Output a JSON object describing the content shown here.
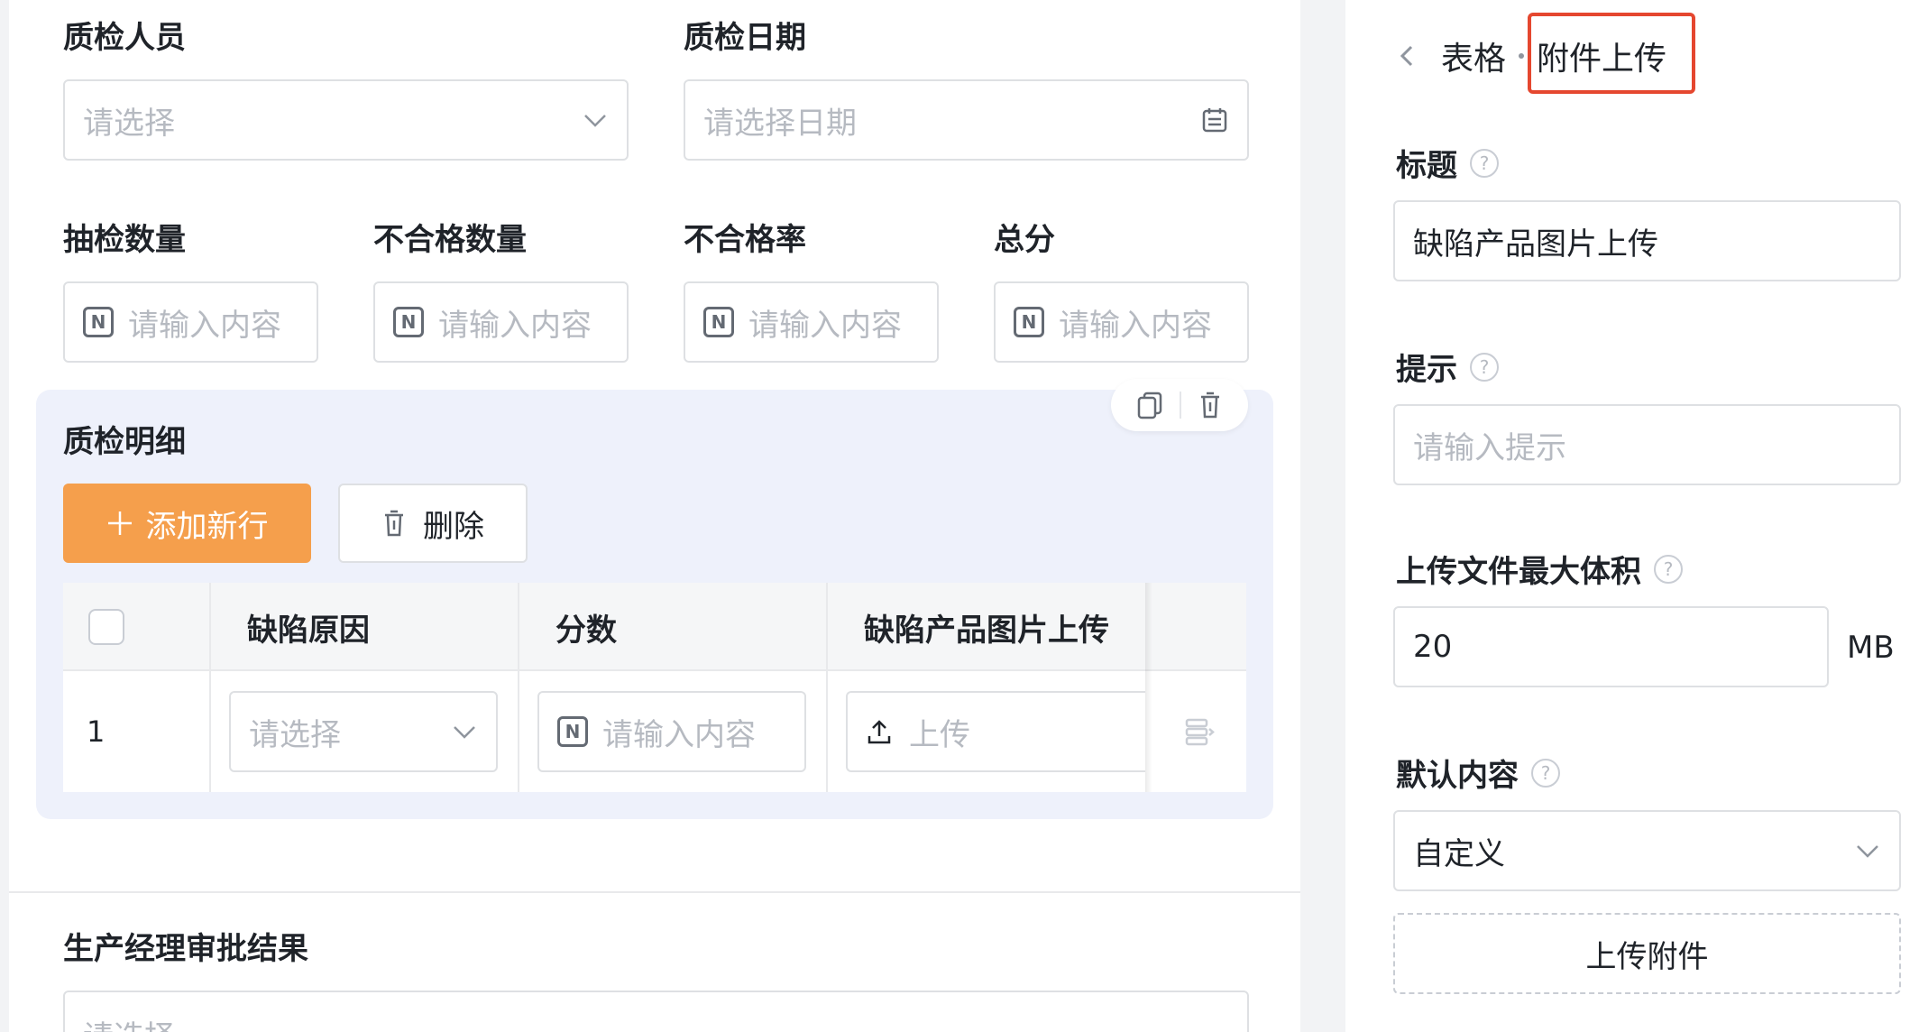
{
  "form": {
    "inspector": {
      "label": "质检人员",
      "placeholder": "请选择"
    },
    "inspection_date": {
      "label": "质检日期",
      "placeholder": "请选择日期"
    },
    "sample_qty": {
      "label": "抽检数量",
      "placeholder": "请输入内容"
    },
    "defect_qty": {
      "label": "不合格数量",
      "placeholder": "请输入内容"
    },
    "defect_rate": {
      "label": "不合格率",
      "placeholder": "请输入内容"
    },
    "total_score": {
      "label": "总分",
      "placeholder": "请输入内容"
    },
    "number_badge": "N",
    "detail": {
      "title": "质检明细",
      "add_row": "添加新行",
      "delete": "删除",
      "columns": [
        "缺陷原因",
        "分数",
        "缺陷产品图片上传"
      ],
      "row": {
        "index": "1",
        "reason_placeholder": "请选择",
        "score_placeholder": "请输入内容",
        "upload_label": "上传"
      }
    },
    "approval": {
      "label": "生产经理审批结果",
      "placeholder": "请选择"
    }
  },
  "panel": {
    "breadcrumb": {
      "parent": "表格",
      "current": "附件上传"
    },
    "title_field": {
      "label": "标题",
      "value": "缺陷产品图片上传"
    },
    "hint_field": {
      "label": "提示",
      "placeholder": "请输入提示"
    },
    "max_size_field": {
      "label": "上传文件最大体积",
      "value": "20",
      "unit": "MB"
    },
    "default_field": {
      "label": "默认内容",
      "value": "自定义"
    },
    "upload_attachment": "上传附件",
    "help_glyph": "?"
  },
  "colors": {
    "accent_orange": "#f59f4c",
    "highlight_red": "#e5472f",
    "detail_bg": "#eef1fb"
  }
}
